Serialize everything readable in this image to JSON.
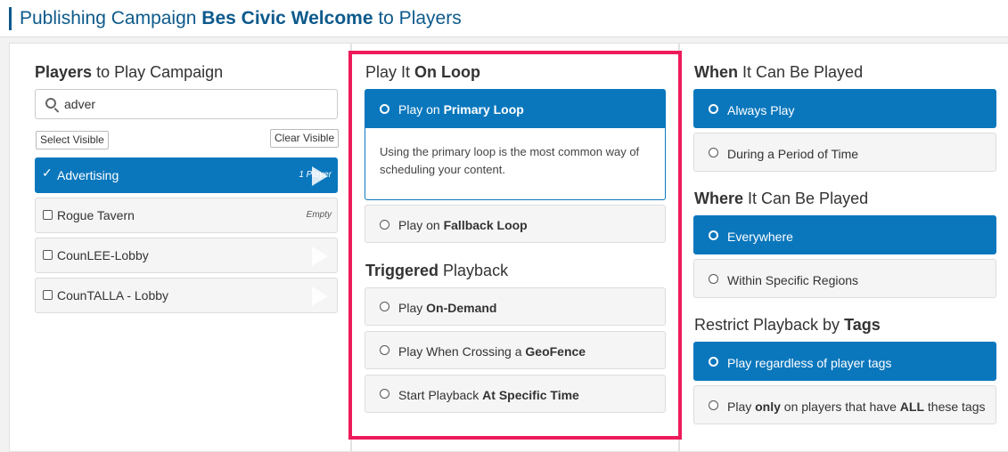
{
  "header": {
    "title_prefix": "Publishing Campaign ",
    "campaign_name": "Bes Civic Welcome",
    "title_suffix": " to Players"
  },
  "players": {
    "title_bold": "Players",
    "title_rest": " to Play Campaign",
    "search_value": "adver",
    "select_visible": "Select Visible",
    "clear_visible": "Clear Visible",
    "items": [
      {
        "name": "Advertising",
        "count": "1 Player",
        "checked": true
      },
      {
        "name": "Rogue Tavern",
        "count": "Empty",
        "checked": false
      },
      {
        "name": "CounLEE-Lobby",
        "count": "",
        "checked": false
      },
      {
        "name": "CounTALLA - Lobby",
        "count": "",
        "checked": false
      }
    ]
  },
  "loop": {
    "title_rest": "Play It ",
    "title_bold": "On Loop",
    "primary_prefix": "Play on ",
    "primary_bold": "Primary Loop",
    "primary_desc": "Using the primary loop is the most common way of scheduling your content.",
    "fallback_prefix": "Play on ",
    "fallback_bold": "Fallback Loop"
  },
  "triggered": {
    "title_bold": "Triggered",
    "title_rest": " Playback",
    "on_demand_prefix": "Play ",
    "on_demand_bold": "On-Demand",
    "geofence_prefix": "Play When Crossing a ",
    "geofence_bold": "GeoFence",
    "specific_prefix": "Start Playback ",
    "specific_bold": "At Specific Time"
  },
  "when": {
    "title_bold": "When",
    "title_rest": " It Can Be Played",
    "always": "Always Play",
    "period": "During a Period of Time"
  },
  "where": {
    "title_bold": "Where",
    "title_rest": " It Can Be Played",
    "everywhere": "Everywhere",
    "regions": "Within Specific Regions"
  },
  "tags": {
    "title_rest": "Restrict Playback by ",
    "title_bold": "Tags",
    "regardless": "Play regardless of player tags",
    "only_prefix": "Play ",
    "only_bold": "only",
    "only_mid": " on players that have ",
    "only_bold2": "ALL",
    "only_suffix": " these tags"
  },
  "colors": {
    "accent": "#0a77bd",
    "title": "#0d5a8c",
    "highlight": "#ee1b5a"
  }
}
